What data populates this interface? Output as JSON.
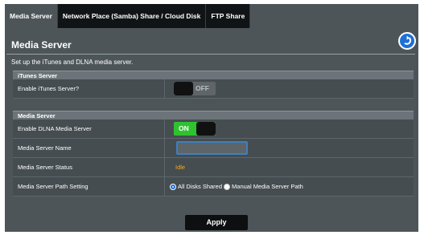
{
  "tabs": [
    {
      "label": "Media Server"
    },
    {
      "label": "Network Place (Samba) Share / Cloud Disk"
    },
    {
      "label": "FTP Share"
    }
  ],
  "page": {
    "title": "Media Server",
    "description": "Set up the iTunes and DLNA media server."
  },
  "itunes": {
    "section_title": "iTunes Server",
    "enable_label": "Enable iTunes Server?",
    "toggle_text": "OFF"
  },
  "media": {
    "section_title": "Media Server",
    "dlna_label": "Enable DLNA Media Server",
    "dlna_toggle_text": "ON",
    "name_label": "Media Server Name",
    "name_value": "",
    "status_label": "Media Server Status",
    "status_value": "Idle",
    "path_label": "Media Server Path Setting",
    "path_options": [
      {
        "label": "All Disks Shared",
        "selected": true
      },
      {
        "label": "Manual Media Server Path",
        "selected": false
      }
    ]
  },
  "apply_label": "Apply",
  "colors": {
    "panel": "#4d5559",
    "tab_inactive": "#111416",
    "toggle_on": "#2fc22f",
    "status": "#f6a81c",
    "accent": "#1f6fd6"
  },
  "icons": {
    "back": "back-arrow-icon"
  }
}
